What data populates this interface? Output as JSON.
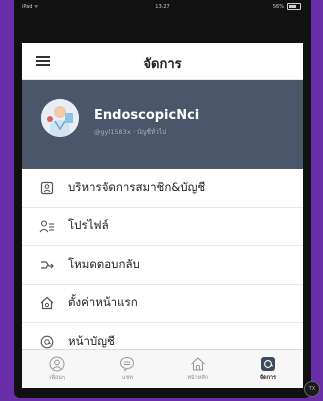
{
  "status_bar": {
    "carrier": "iPad ᯤ",
    "time": "13:27",
    "battery": "56%"
  },
  "header": {
    "title": "จัดการ",
    "menu_icon": "hamburger-icon"
  },
  "profile": {
    "name": "EndoscopicNci",
    "subtitle": "@gyl1583x · บัญชีทั่วไป",
    "avatar_icon": "doctor-avatar"
  },
  "menu": {
    "items": [
      {
        "label": "บริหารจัดการสมาชิก&บัญชี",
        "icon": "member-card-icon"
      },
      {
        "label": "โปรไฟล์",
        "icon": "profile-icon"
      },
      {
        "label": "โหมดตอบกลับ",
        "icon": "reply-mode-icon"
      },
      {
        "label": "ตั้งค่าหน้าแรก",
        "icon": "home-settings-icon"
      },
      {
        "label": "หน้าบัญชี",
        "icon": "account-page-icon"
      }
    ]
  },
  "tabs": [
    {
      "label": "เพื่อนๆ",
      "icon": "friends-icon",
      "active": false
    },
    {
      "label": "แชท",
      "icon": "chat-icon",
      "active": false
    },
    {
      "label": "หน้าหลัก",
      "icon": "home-icon",
      "active": false
    },
    {
      "label": "จัดการ",
      "icon": "manage-icon",
      "active": true
    }
  ],
  "overlay": {
    "corner_label": "TX"
  },
  "colors": {
    "frame": "#6a2fa8",
    "profile_bg": "#4b566b",
    "text": "#222222"
  }
}
